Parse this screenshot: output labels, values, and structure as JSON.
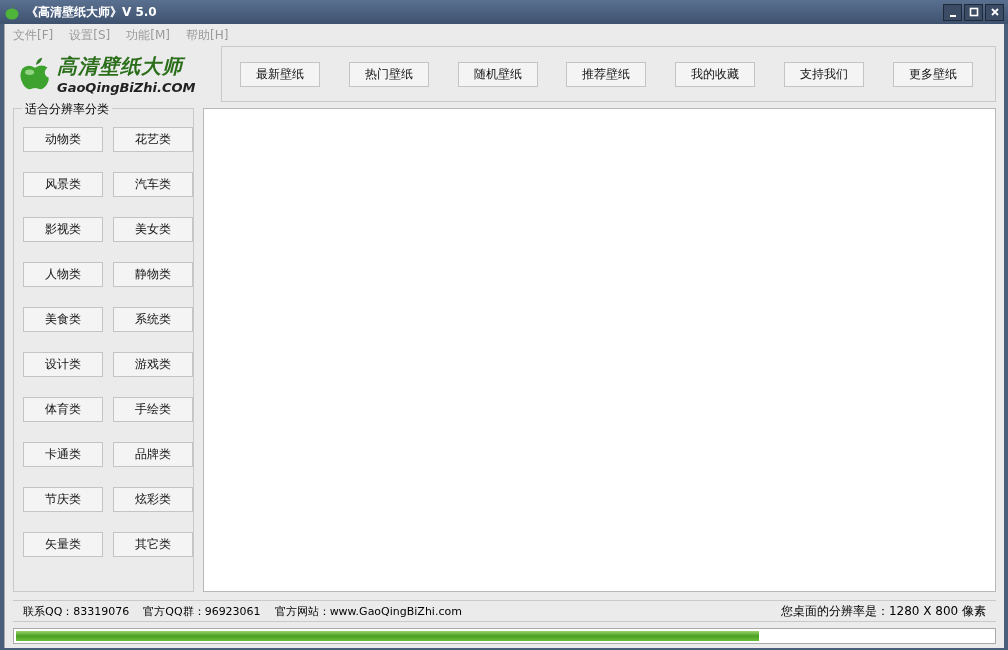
{
  "window": {
    "title": "《高清壁纸大师》V 5.0"
  },
  "menu": [
    {
      "label": "文件[F]",
      "disabled": true
    },
    {
      "label": "设置[S]",
      "disabled": true
    },
    {
      "label": "功能[M]",
      "disabled": true
    },
    {
      "label": "帮助[H]",
      "disabled": true
    }
  ],
  "logo": {
    "title": "高清壁纸大师",
    "subtitle": "GaoQingBiZhi.COM"
  },
  "toolbar": [
    "最新壁纸",
    "热门壁纸",
    "随机壁纸",
    "推荐壁纸",
    "我的收藏",
    "支持我们",
    "更多壁纸"
  ],
  "categories": {
    "title": "适合分辨率分类",
    "items": [
      "动物类",
      "花艺类",
      "风景类",
      "汽车类",
      "影视类",
      "美女类",
      "人物类",
      "静物类",
      "美食类",
      "系统类",
      "设计类",
      "游戏类",
      "体育类",
      "手绘类",
      "卡通类",
      "品牌类",
      "节庆类",
      "炫彩类",
      "矢量类",
      "其它类"
    ]
  },
  "status_bar": {
    "contact": "联系QQ：83319076",
    "group": "官方QQ群：96923061",
    "website": "官方网站：www.GaoQingBiZhi.com",
    "resolution": "您桌面的分辨率是：1280 X 800 像素"
  },
  "progress": {
    "level": 0.76
  }
}
